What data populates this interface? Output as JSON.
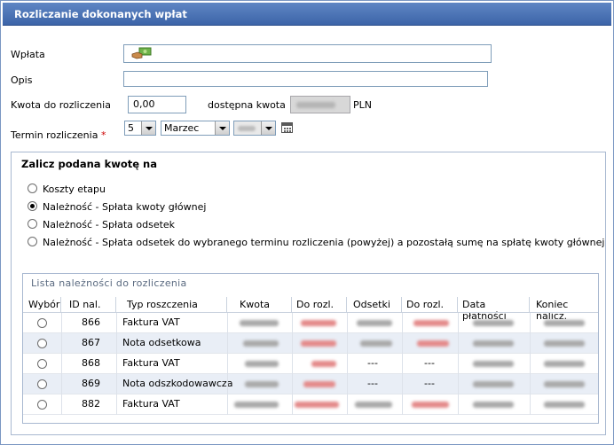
{
  "window": {
    "title": "Rozliczanie dokonanych wpłat"
  },
  "form": {
    "wplata_label": "Wpłata",
    "opis_label": "Opis",
    "opis_value": "",
    "kwota_label": "Kwota do rozliczenia",
    "kwota_value": "0,00",
    "dostepna_label": "dostępna kwota",
    "currency": "PLN",
    "termin_label": "Termin rozliczenia",
    "required_mark": "*",
    "day_value": "5",
    "month_value": "Marzec"
  },
  "options_group": {
    "title": "Zalicz podana kwotę na",
    "options": [
      {
        "label": "Koszty etapu",
        "selected": false
      },
      {
        "label": "Należność - Spłata kwoty głównej",
        "selected": true
      },
      {
        "label": "Należność - Spłata odsetek",
        "selected": false
      },
      {
        "label": "Należność - Spłata odsetek do wybranego terminu rozliczenia (powyżej) a pozostałą sumę na spłatę kwoty głównej",
        "selected": false
      }
    ]
  },
  "list": {
    "title": "Lista należności do rozliczenia",
    "columns": [
      "Wybór",
      "ID nal.",
      "Typ roszczenia",
      "Kwota",
      "Do rozl.",
      "Odsetki",
      "Do rozl.",
      "Data płatności",
      "Koniec nalicz."
    ],
    "rows": [
      {
        "id": "866",
        "typ": "Faktura VAT",
        "odsetki": "",
        "do_rozl2": ""
      },
      {
        "id": "867",
        "typ": "Nota odsetkowa",
        "odsetki": "",
        "do_rozl2": ""
      },
      {
        "id": "868",
        "typ": "Faktura VAT",
        "odsetki": "---",
        "do_rozl2": "---"
      },
      {
        "id": "869",
        "typ": "Nota odszkodowawcza",
        "odsetki": "---",
        "do_rozl2": "---"
      },
      {
        "id": "882",
        "typ": "Faktura VAT",
        "odsetki": "",
        "do_rozl2": ""
      }
    ]
  },
  "colors": {
    "title_bar": "#4a72b5",
    "accent_red": "#cc0000",
    "row_alt": "#e9eef6"
  }
}
